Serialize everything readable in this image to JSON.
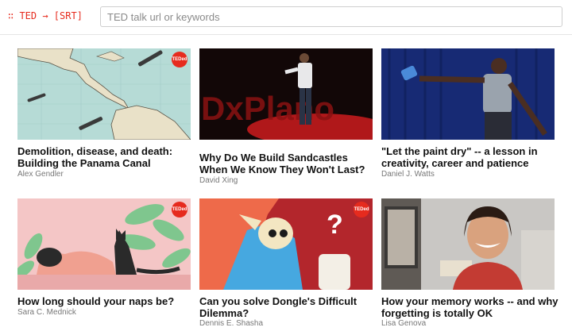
{
  "header": {
    "logo_text": "∷ TED → [SRT]",
    "search_placeholder": "TED talk url or keywords"
  },
  "colors": {
    "accent": "#e62b1e"
  },
  "talks": [
    {
      "title": "Demolition, disease, and death: Building the Panama Canal",
      "speaker": "Alex Gendler",
      "badge": "TEDed"
    },
    {
      "title": "Why Do We Build Sandcastles When We Know They Won't Last?",
      "speaker": "David Xing",
      "stage_text": "DxPlano"
    },
    {
      "title": "\"Let the paint dry\" -- a lesson in creativity, career and patience",
      "speaker": "Daniel J. Watts"
    },
    {
      "title": "How long should your naps be?",
      "speaker": "Sara C. Mednick",
      "badge": "TEDed"
    },
    {
      "title": "Can you solve Dongle's Difficult Dilemma?",
      "speaker": "Dennis E. Shasha",
      "badge": "TEDed"
    },
    {
      "title": "How your memory works -- and why forgetting is totally OK",
      "speaker": "Lisa Genova"
    }
  ]
}
